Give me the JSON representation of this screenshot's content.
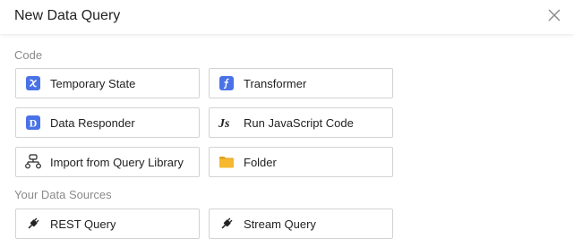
{
  "dialog": {
    "title": "New Data Query"
  },
  "sections": {
    "code_label": "Code",
    "sources_label": "Your Data Sources"
  },
  "items": {
    "temporary_state": "Temporary State",
    "transformer": "Transformer",
    "data_responder": "Data Responder",
    "run_js": "Run JavaScript Code",
    "import_library": "Import from Query Library",
    "folder": "Folder",
    "rest_query": "REST Query",
    "stream_query": "Stream Query"
  },
  "icons": {
    "temporary_state": "variable-x-icon",
    "transformer": "function-f-icon",
    "data_responder": "d-letter-icon",
    "run_js": "javascript-icon",
    "import_library": "network-share-icon",
    "folder": "folder-icon",
    "rest_query": "plug-icon",
    "stream_query": "plug-icon",
    "close": "close-icon"
  },
  "colors": {
    "icon_blue": "#4a72e8",
    "folder_yellow": "#f5b82e",
    "text_dark": "#222222",
    "text_muted": "#8a8a8a",
    "border": "#d3d3d3"
  }
}
